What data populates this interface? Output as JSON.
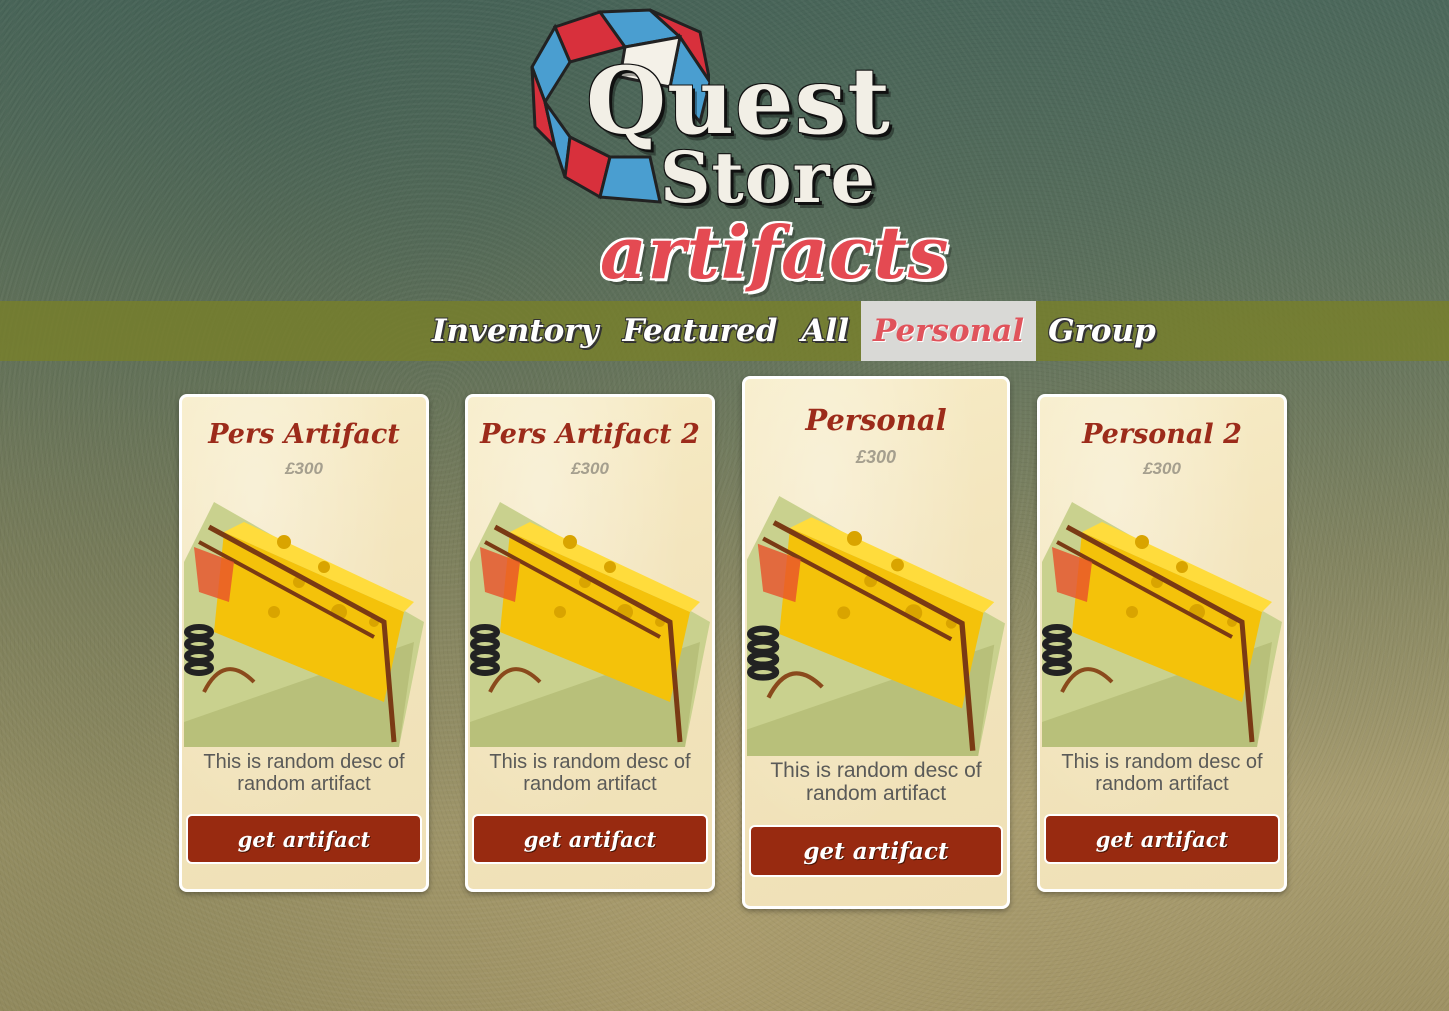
{
  "logo": {
    "line1": "Quest",
    "line2": "Store",
    "subtitle": "artifacts"
  },
  "nav": {
    "items": [
      {
        "label": "Inventory",
        "active": false
      },
      {
        "label": "Featured",
        "active": false
      },
      {
        "label": "All",
        "active": false
      },
      {
        "label": "Personal",
        "active": true
      },
      {
        "label": "Group",
        "active": false
      }
    ]
  },
  "cards": [
    {
      "title": "Pers Artifact",
      "price": "£300",
      "image": "mousetrap-cheese",
      "description": "This is random desc of random artifact",
      "button": "get artifact",
      "highlighted": false
    },
    {
      "title": "Pers Artifact 2",
      "price": "£300",
      "image": "mousetrap-cheese",
      "description": "This is random desc of random artifact",
      "button": "get artifact",
      "highlighted": false
    },
    {
      "title": "Personal",
      "price": "£300",
      "image": "mousetrap-cheese",
      "description": "This is random desc of random artifact",
      "button": "get artifact",
      "highlighted": true
    },
    {
      "title": "Personal 2",
      "price": "£300",
      "image": "mousetrap-cheese",
      "description": "This is random desc of random artifact",
      "button": "get artifact",
      "highlighted": false
    }
  ],
  "colors": {
    "nav_bar": "#7a8028",
    "active_tab_text": "#e0535b",
    "card_title": "#9c2b1a",
    "button": "#982a10",
    "logo_subtitle": "#e44a52"
  }
}
